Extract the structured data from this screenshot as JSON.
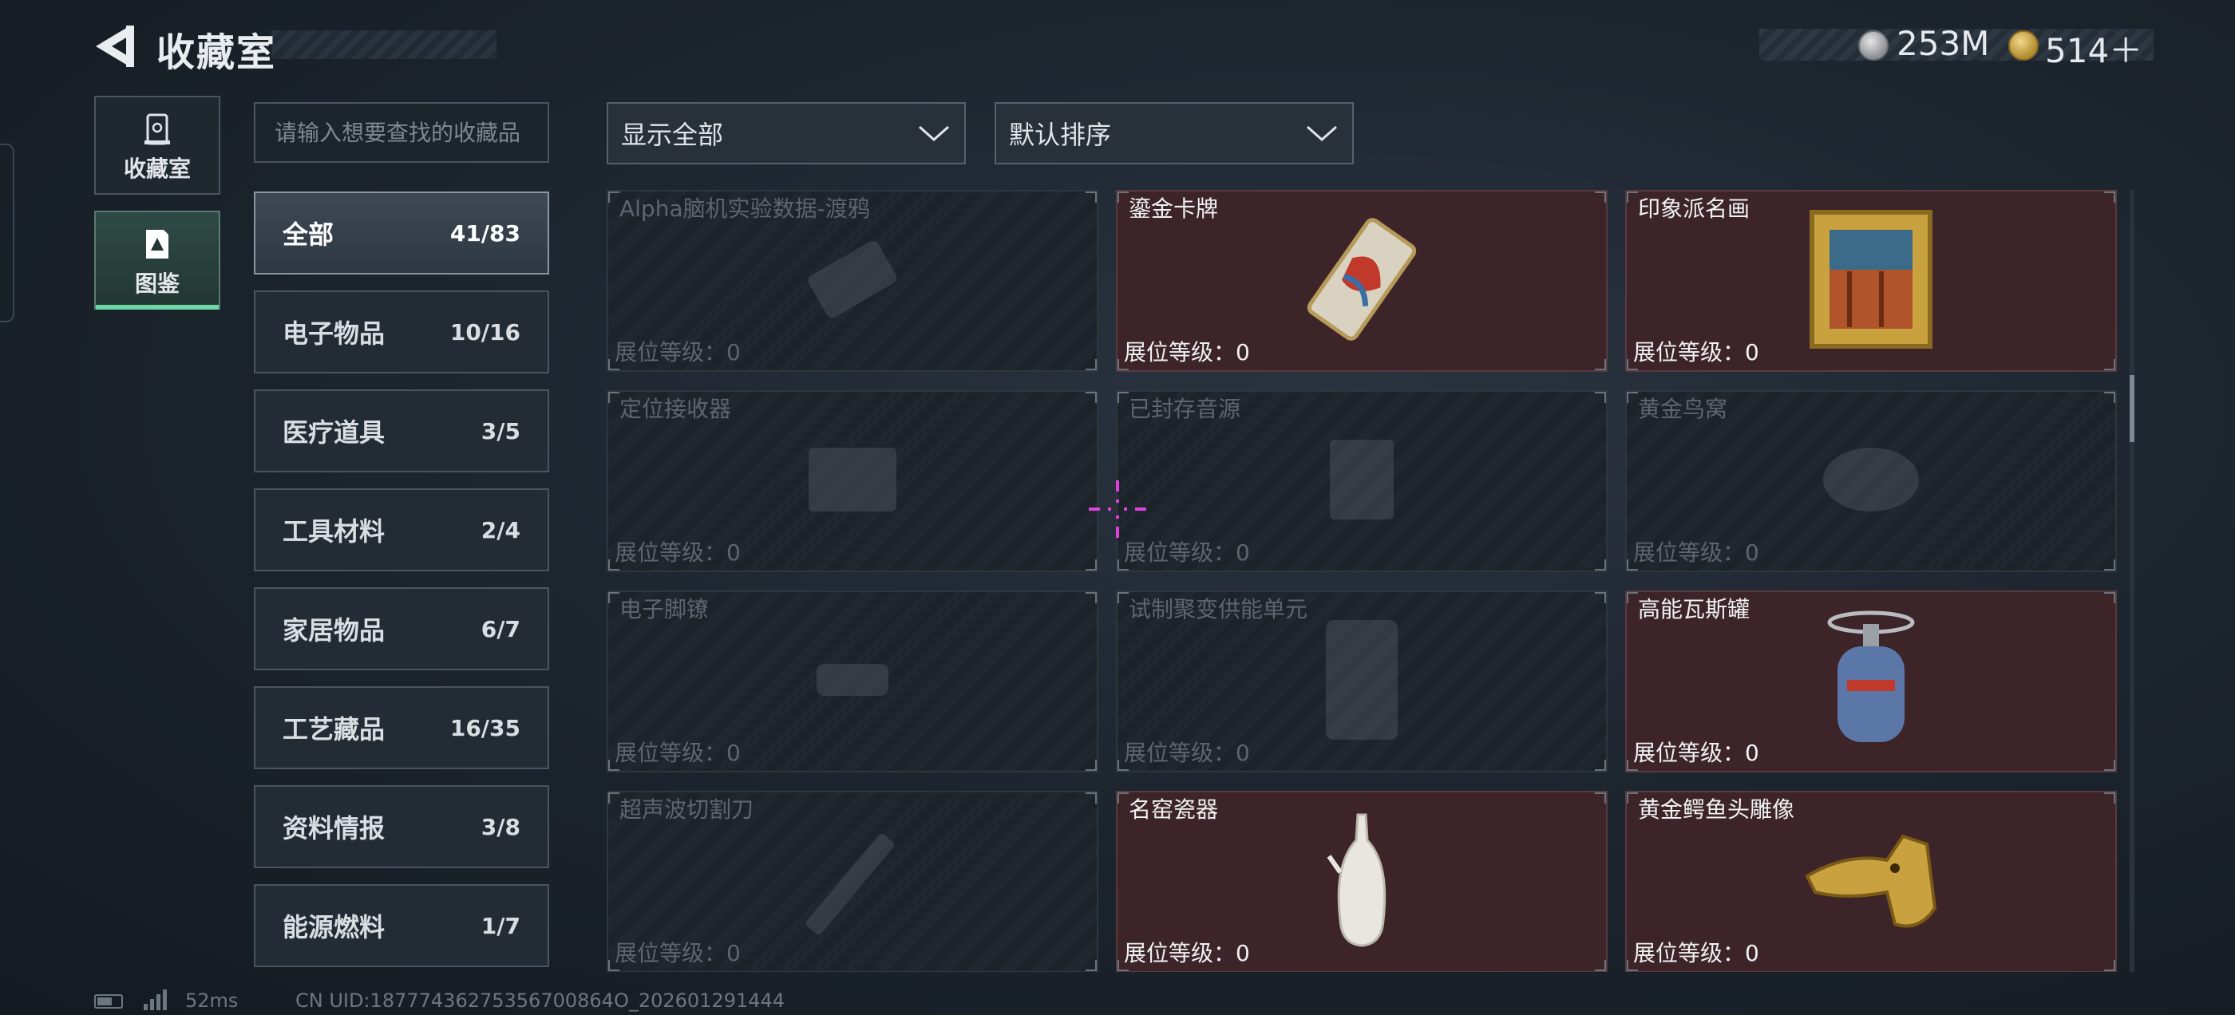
{
  "header": {
    "title": "收藏室",
    "currency": [
      {
        "icon": "silver-coin-icon",
        "value": "253M"
      },
      {
        "icon": "gold-coin-icon",
        "value": "514＋"
      }
    ]
  },
  "side_tabs": [
    {
      "label": "收藏室",
      "icon": "collection-room-icon",
      "active": false
    },
    {
      "label": "图鉴",
      "icon": "codex-icon",
      "active": true
    }
  ],
  "search": {
    "placeholder": "请输入想要查找的收藏品"
  },
  "categories": [
    {
      "name": "全部",
      "count": "41/83",
      "active": true
    },
    {
      "name": "电子物品",
      "count": "10/16"
    },
    {
      "name": "医疗道具",
      "count": "3/5"
    },
    {
      "name": "工具材料",
      "count": "2/4"
    },
    {
      "name": "家居物品",
      "count": "6/7"
    },
    {
      "name": "工艺藏品",
      "count": "16/35"
    },
    {
      "name": "资料情报",
      "count": "3/8"
    },
    {
      "name": "能源燃料",
      "count": "1/7"
    }
  ],
  "filters": {
    "display": "显示全部",
    "sort": "默认排序"
  },
  "level_label": "展位等级：0",
  "items": [
    {
      "name": "Alpha脑机实验数据-渡鸦",
      "unlocked": false,
      "icon": "data-drive-icon"
    },
    {
      "name": "鎏金卡牌",
      "unlocked": true,
      "icon": "gilded-card-icon"
    },
    {
      "name": "印象派名画",
      "unlocked": true,
      "icon": "framed-painting-icon"
    },
    {
      "name": "定位接收器",
      "unlocked": false,
      "icon": "receiver-icon"
    },
    {
      "name": "已封存音源",
      "unlocked": false,
      "icon": "audio-device-icon"
    },
    {
      "name": "黄金鸟窝",
      "unlocked": false,
      "icon": "bird-nest-icon"
    },
    {
      "name": "电子脚镣",
      "unlocked": false,
      "icon": "ankle-monitor-icon"
    },
    {
      "name": "试制聚变供能单元",
      "unlocked": false,
      "icon": "fusion-unit-icon"
    },
    {
      "name": "高能瓦斯罐",
      "unlocked": true,
      "icon": "gas-canister-icon"
    },
    {
      "name": "超声波切割刀",
      "unlocked": false,
      "icon": "ultrasonic-cutter-icon"
    },
    {
      "name": "名窑瓷器",
      "unlocked": true,
      "icon": "porcelain-vase-icon"
    },
    {
      "name": "黄金鳄鱼头雕像",
      "unlocked": true,
      "icon": "gold-crocodile-head-icon"
    }
  ],
  "footer": {
    "ping": "52ms",
    "uid": "CN UID:18777436275356700864O_202601291444"
  },
  "colors": {
    "accent_green": "#6fd7a4",
    "unlocked_card": "#3d2428",
    "crosshair": "#e040e0"
  }
}
